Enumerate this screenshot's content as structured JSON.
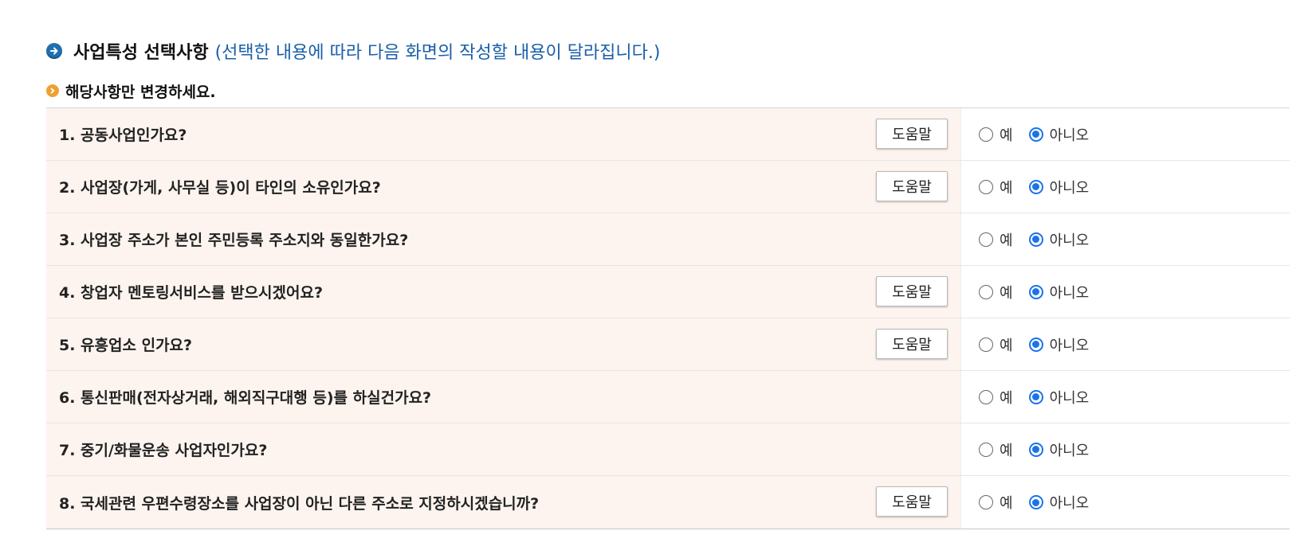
{
  "header": {
    "title": "사업특성 선택사항",
    "note": "(선택한 내용에 따라 다음 화면의 작성할 내용이 달라집니다.)",
    "subtitle": "해당사항만 변경하세요."
  },
  "labels": {
    "help": "도움말",
    "yes": "예",
    "no": "아니오"
  },
  "questions": [
    {
      "text": "1. 공동사업인가요?",
      "has_help": true,
      "answer": "no"
    },
    {
      "text": "2. 사업장(가게, 사무실 등)이 타인의 소유인가요?",
      "has_help": true,
      "answer": "no"
    },
    {
      "text": "3. 사업장 주소가 본인 주민등록 주소지와 동일한가요?",
      "has_help": false,
      "answer": "no"
    },
    {
      "text": "4. 창업자 멘토링서비스를 받으시겠어요?",
      "has_help": true,
      "answer": "no"
    },
    {
      "text": "5. 유흥업소 인가요?",
      "has_help": true,
      "answer": "no"
    },
    {
      "text": "6. 통신판매(전자상거래, 해외직구대행 등)를 하실건가요?",
      "has_help": false,
      "answer": "no"
    },
    {
      "text": "7. 중기/화물운송 사업자인가요?",
      "has_help": false,
      "answer": "no"
    },
    {
      "text": "8. 국세관련 우편수령장소를 사업장이 아닌 다른 주소로 지정하시겠습니까?",
      "has_help": true,
      "answer": "no"
    }
  ],
  "colors": {
    "accent_blue": "#1a5fa8",
    "radio_checked": "#1a73e8",
    "question_bg": "#fdf4ef",
    "bullet_orange": "#f0a030"
  }
}
